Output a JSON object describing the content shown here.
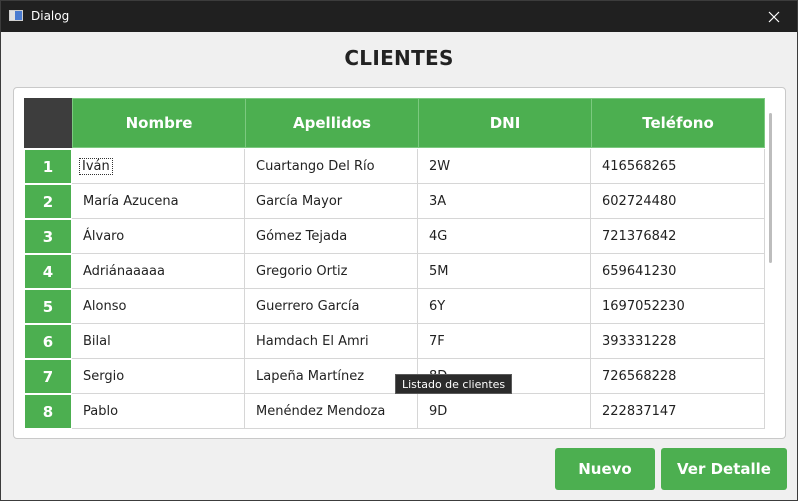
{
  "window": {
    "title": "Dialog"
  },
  "heading": "CLIENTES",
  "table": {
    "columns": [
      "Nombre",
      "Apellidos",
      "DNI",
      "Teléfono"
    ],
    "rows": [
      {
        "num": "1",
        "nombre": "Iván",
        "apellidos": "Cuartango Del Río",
        "dni": "2W",
        "telefono": "416568265"
      },
      {
        "num": "2",
        "nombre": "María Azucena",
        "apellidos": "García Mayor",
        "dni": "3A",
        "telefono": "602724480"
      },
      {
        "num": "3",
        "nombre": "Álvaro",
        "apellidos": "Gómez Tejada",
        "dni": "4G",
        "telefono": "721376842"
      },
      {
        "num": "4",
        "nombre": "Adriánaaaaa",
        "apellidos": "Gregorio Ortiz",
        "dni": "5M",
        "telefono": "659641230"
      },
      {
        "num": "5",
        "nombre": "Alonso",
        "apellidos": "Guerrero García",
        "dni": "6Y",
        "telefono": "1697052230"
      },
      {
        "num": "6",
        "nombre": "Bilal",
        "apellidos": "Hamdach El Amri",
        "dni": "7F",
        "telefono": "393331228"
      },
      {
        "num": "7",
        "nombre": "Sergio",
        "apellidos": "Lapeña Martínez",
        "dni": "8D",
        "telefono": "726568228"
      },
      {
        "num": "8",
        "nombre": "Pablo",
        "apellidos": "Menéndez Mendoza",
        "dni": "9D",
        "telefono": "222837147"
      }
    ]
  },
  "tooltip": "Listado de clientes",
  "buttons": {
    "nuevo": "Nuevo",
    "ver_detalle": "Ver Detalle"
  },
  "icons": {
    "app": "dialog-window-icon",
    "close": "close-icon"
  },
  "colors": {
    "accent": "#4caf50",
    "titlebar": "#202020",
    "corner": "#3d3d3d"
  }
}
